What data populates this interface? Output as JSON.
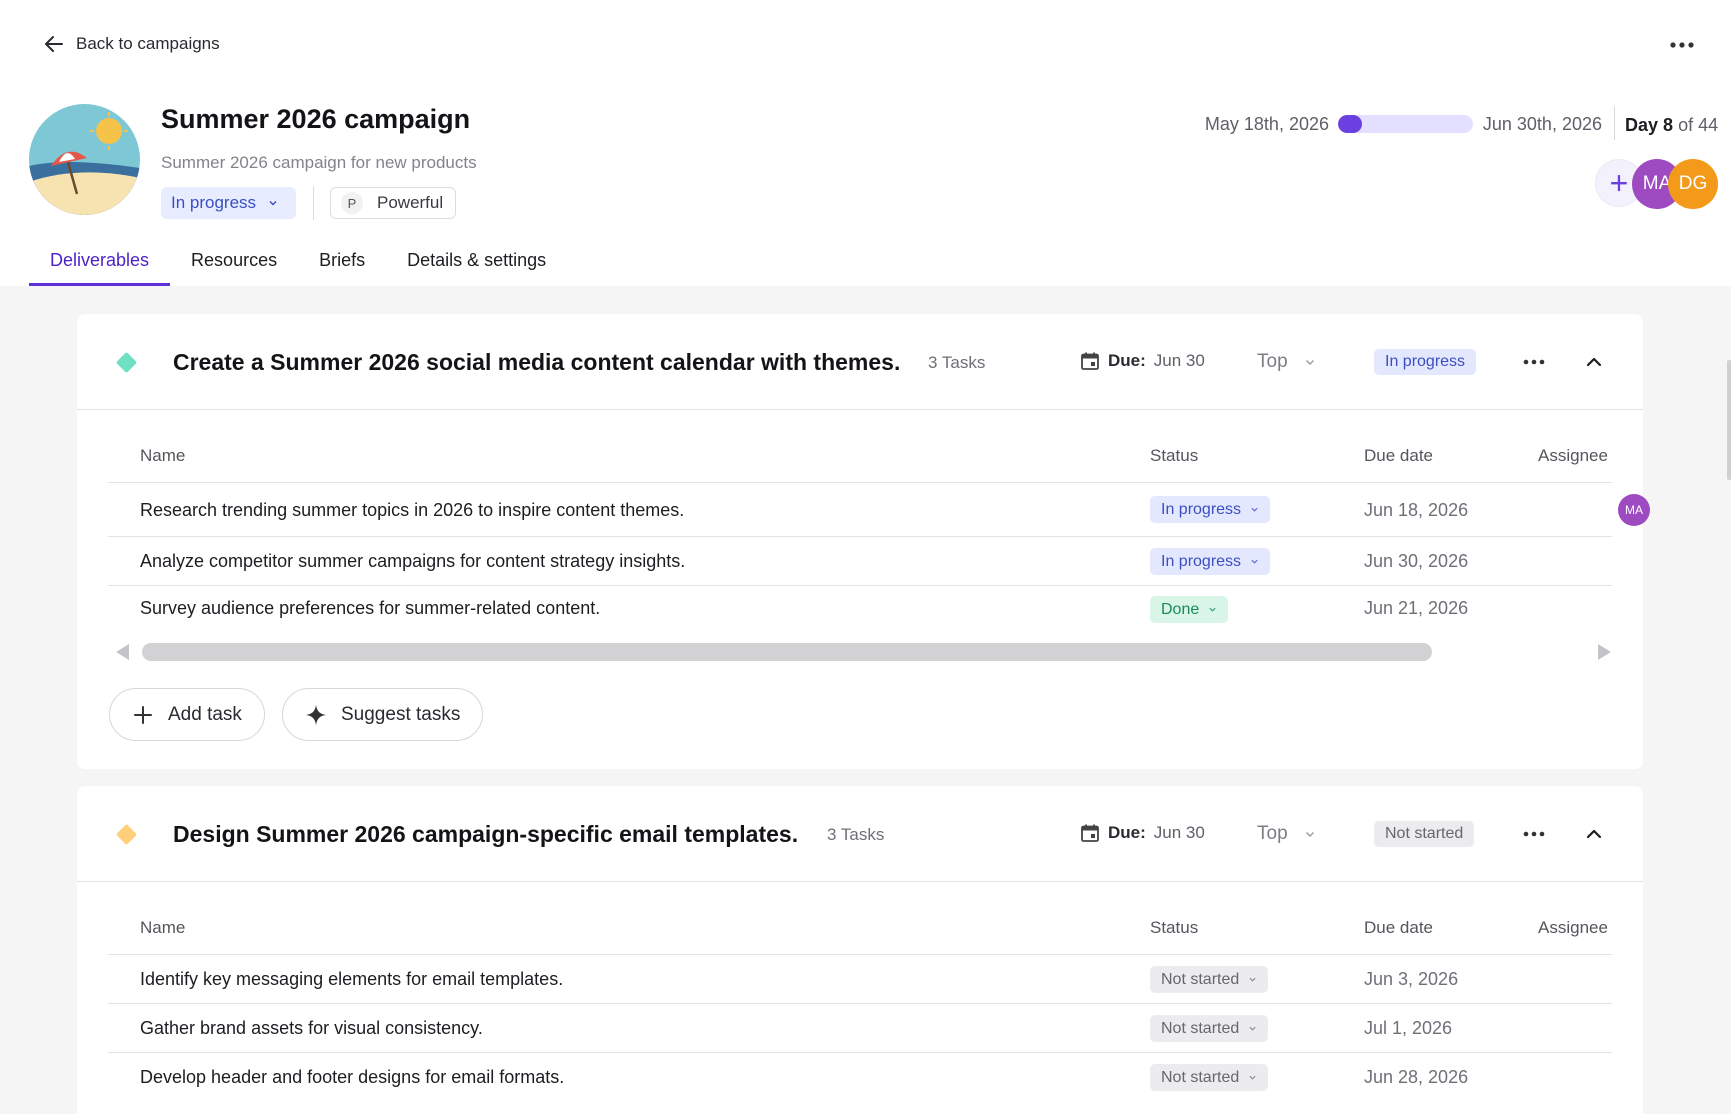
{
  "header": {
    "back_label": "Back to campaigns",
    "title": "Summer 2026 campaign",
    "description": "Summer 2026 campaign for new products",
    "status": "In progress",
    "brand_initial": "P",
    "brand_name": "Powerful",
    "start_date": "May 18th, 2026",
    "end_date": "Jun 30th, 2026",
    "progress_fraction": 0.18,
    "day_prefix": "Day",
    "day_current": "8",
    "day_suffix": "of 44",
    "members": [
      "MA",
      "DG"
    ],
    "add_member_symbol": "+"
  },
  "tabs": [
    {
      "label": "Deliverables",
      "active": true
    },
    {
      "label": "Resources",
      "active": false
    },
    {
      "label": "Briefs",
      "active": false
    },
    {
      "label": "Details & settings",
      "active": false
    }
  ],
  "columns": {
    "name": "Name",
    "status": "Status",
    "due": "Due date",
    "assignee": "Assignee"
  },
  "deliverables": [
    {
      "title": "Create a Summer 2026 social media content calendar with themes.",
      "task_count": "3 Tasks",
      "due_label": "Due:",
      "due_value": "Jun 30",
      "priority": "Top",
      "status": "In progress",
      "color": "#6fe0c4",
      "tasks": [
        {
          "name": "Research trending summer topics in 2026 to inspire content themes.",
          "status": "In progress",
          "due": "Jun 18, 2026",
          "assignee": "MA"
        },
        {
          "name": "Analyze competitor summer campaigns for content strategy insights.",
          "status": "In progress",
          "due": "Jun 30, 2026",
          "assignee": ""
        },
        {
          "name": "Survey audience preferences for summer-related content.",
          "status": "Done",
          "due": "Jun 21, 2026",
          "assignee": ""
        }
      ],
      "add_task_label": "Add task",
      "suggest_tasks_label": "Suggest tasks"
    },
    {
      "title": "Design Summer 2026 campaign-specific email templates.",
      "task_count": "3 Tasks",
      "due_label": "Due:",
      "due_value": "Jun 30",
      "priority": "Top",
      "status": "Not started",
      "color": "#ffcf7a",
      "tasks": [
        {
          "name": "Identify key messaging elements for email templates.",
          "status": "Not started",
          "due": "Jun 3, 2026",
          "assignee": ""
        },
        {
          "name": "Gather brand assets for visual consistency.",
          "status": "Not started",
          "due": "Jul 1, 2026",
          "assignee": ""
        },
        {
          "name": "Develop header and footer designs for email formats.",
          "status": "Not started",
          "due": "Jun 28, 2026",
          "assignee": ""
        }
      ]
    }
  ],
  "colors": {
    "accent": "#5c30d6",
    "status_in_progress": "#e3e8ff",
    "status_not_started": "#ececef",
    "status_done": "#d8f5e8",
    "avatar_ma": "#9e4bc1",
    "avatar_dg": "#f39a1a"
  },
  "icons": {
    "back": "arrow-left-icon",
    "more": "more-horizontal-icon",
    "calendar": "calendar-icon",
    "collapse": "chevron-up-icon",
    "add": "plus-icon",
    "suggest": "sparkle-icon"
  }
}
